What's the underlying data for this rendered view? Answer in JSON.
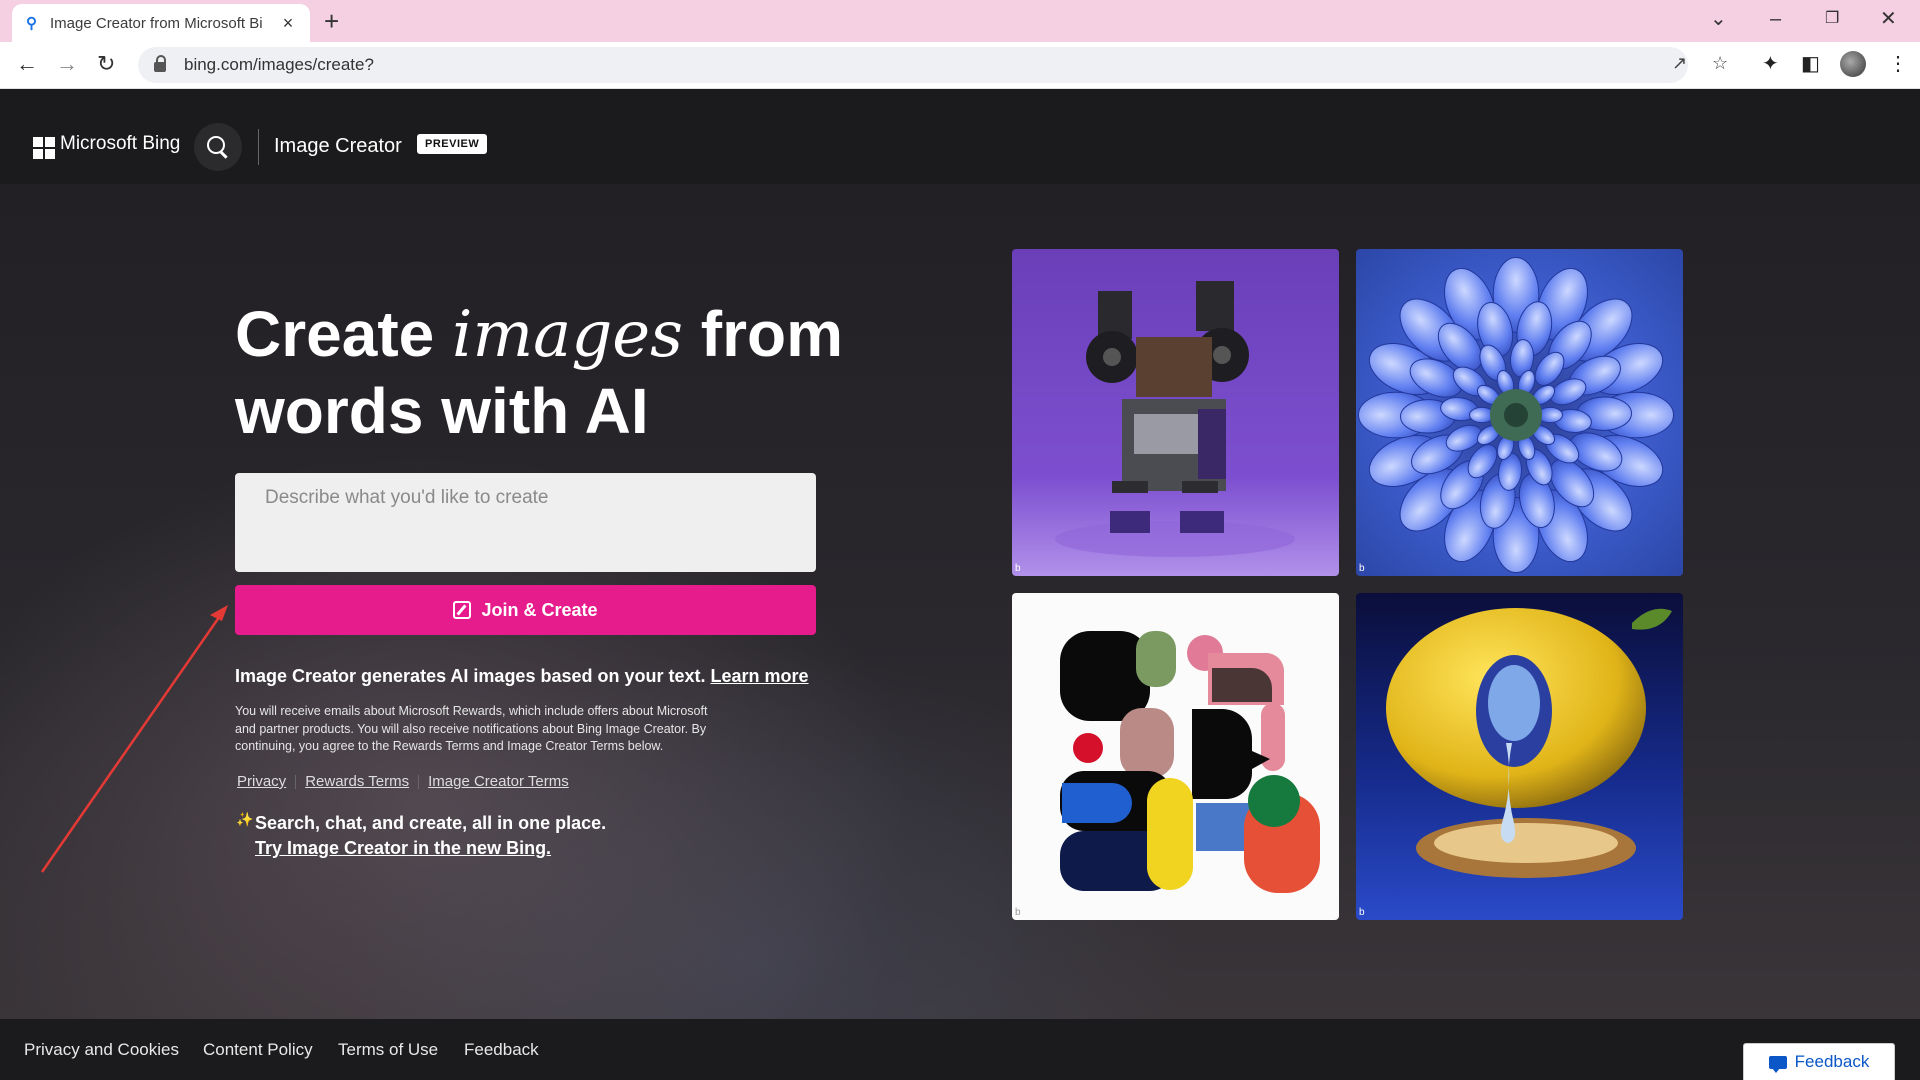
{
  "browser": {
    "tab_title": "Image Creator from Microsoft Bi",
    "url": "bing.com/images/create?",
    "new_tab": "+",
    "close_tab": "×"
  },
  "header": {
    "brand": "Microsoft Bing",
    "section": "Image Creator",
    "badge": "PREVIEW"
  },
  "hero": {
    "headline_part1": "Create ",
    "headline_italic": "images",
    "headline_part2": " from",
    "headline_line2": "words with AI",
    "prompt_placeholder": "Describe what you'd like to create",
    "create_button": "Join & Create",
    "info_text": "Image Creator generates AI images based on your text.",
    "learn_more": "Learn more",
    "fine_print": "You will receive emails about Microsoft Rewards, which include offers about Microsoft and partner products. You will also receive notifications about Bing Image Creator. By continuing, you agree to the Rewards Terms and Image Creator Terms below.",
    "links": [
      "Privacy",
      "Rewards Terms",
      "Image Creator Terms"
    ],
    "promo_line1": "Search, chat, and create, all in one place.",
    "promo_line2": "Try Image Creator in the new Bing."
  },
  "gallery": {
    "mark": "b"
  },
  "footer": {
    "links": [
      "Privacy and Cookies",
      "Content Policy",
      "Terms of Use",
      "Feedback"
    ],
    "feedback_button": "Feedback"
  },
  "colors": {
    "accent": "#e61c8c",
    "tabbar": "#f5cfe2",
    "page_bg": "#1b1a1c",
    "annotation_arrow": "#e53935"
  }
}
